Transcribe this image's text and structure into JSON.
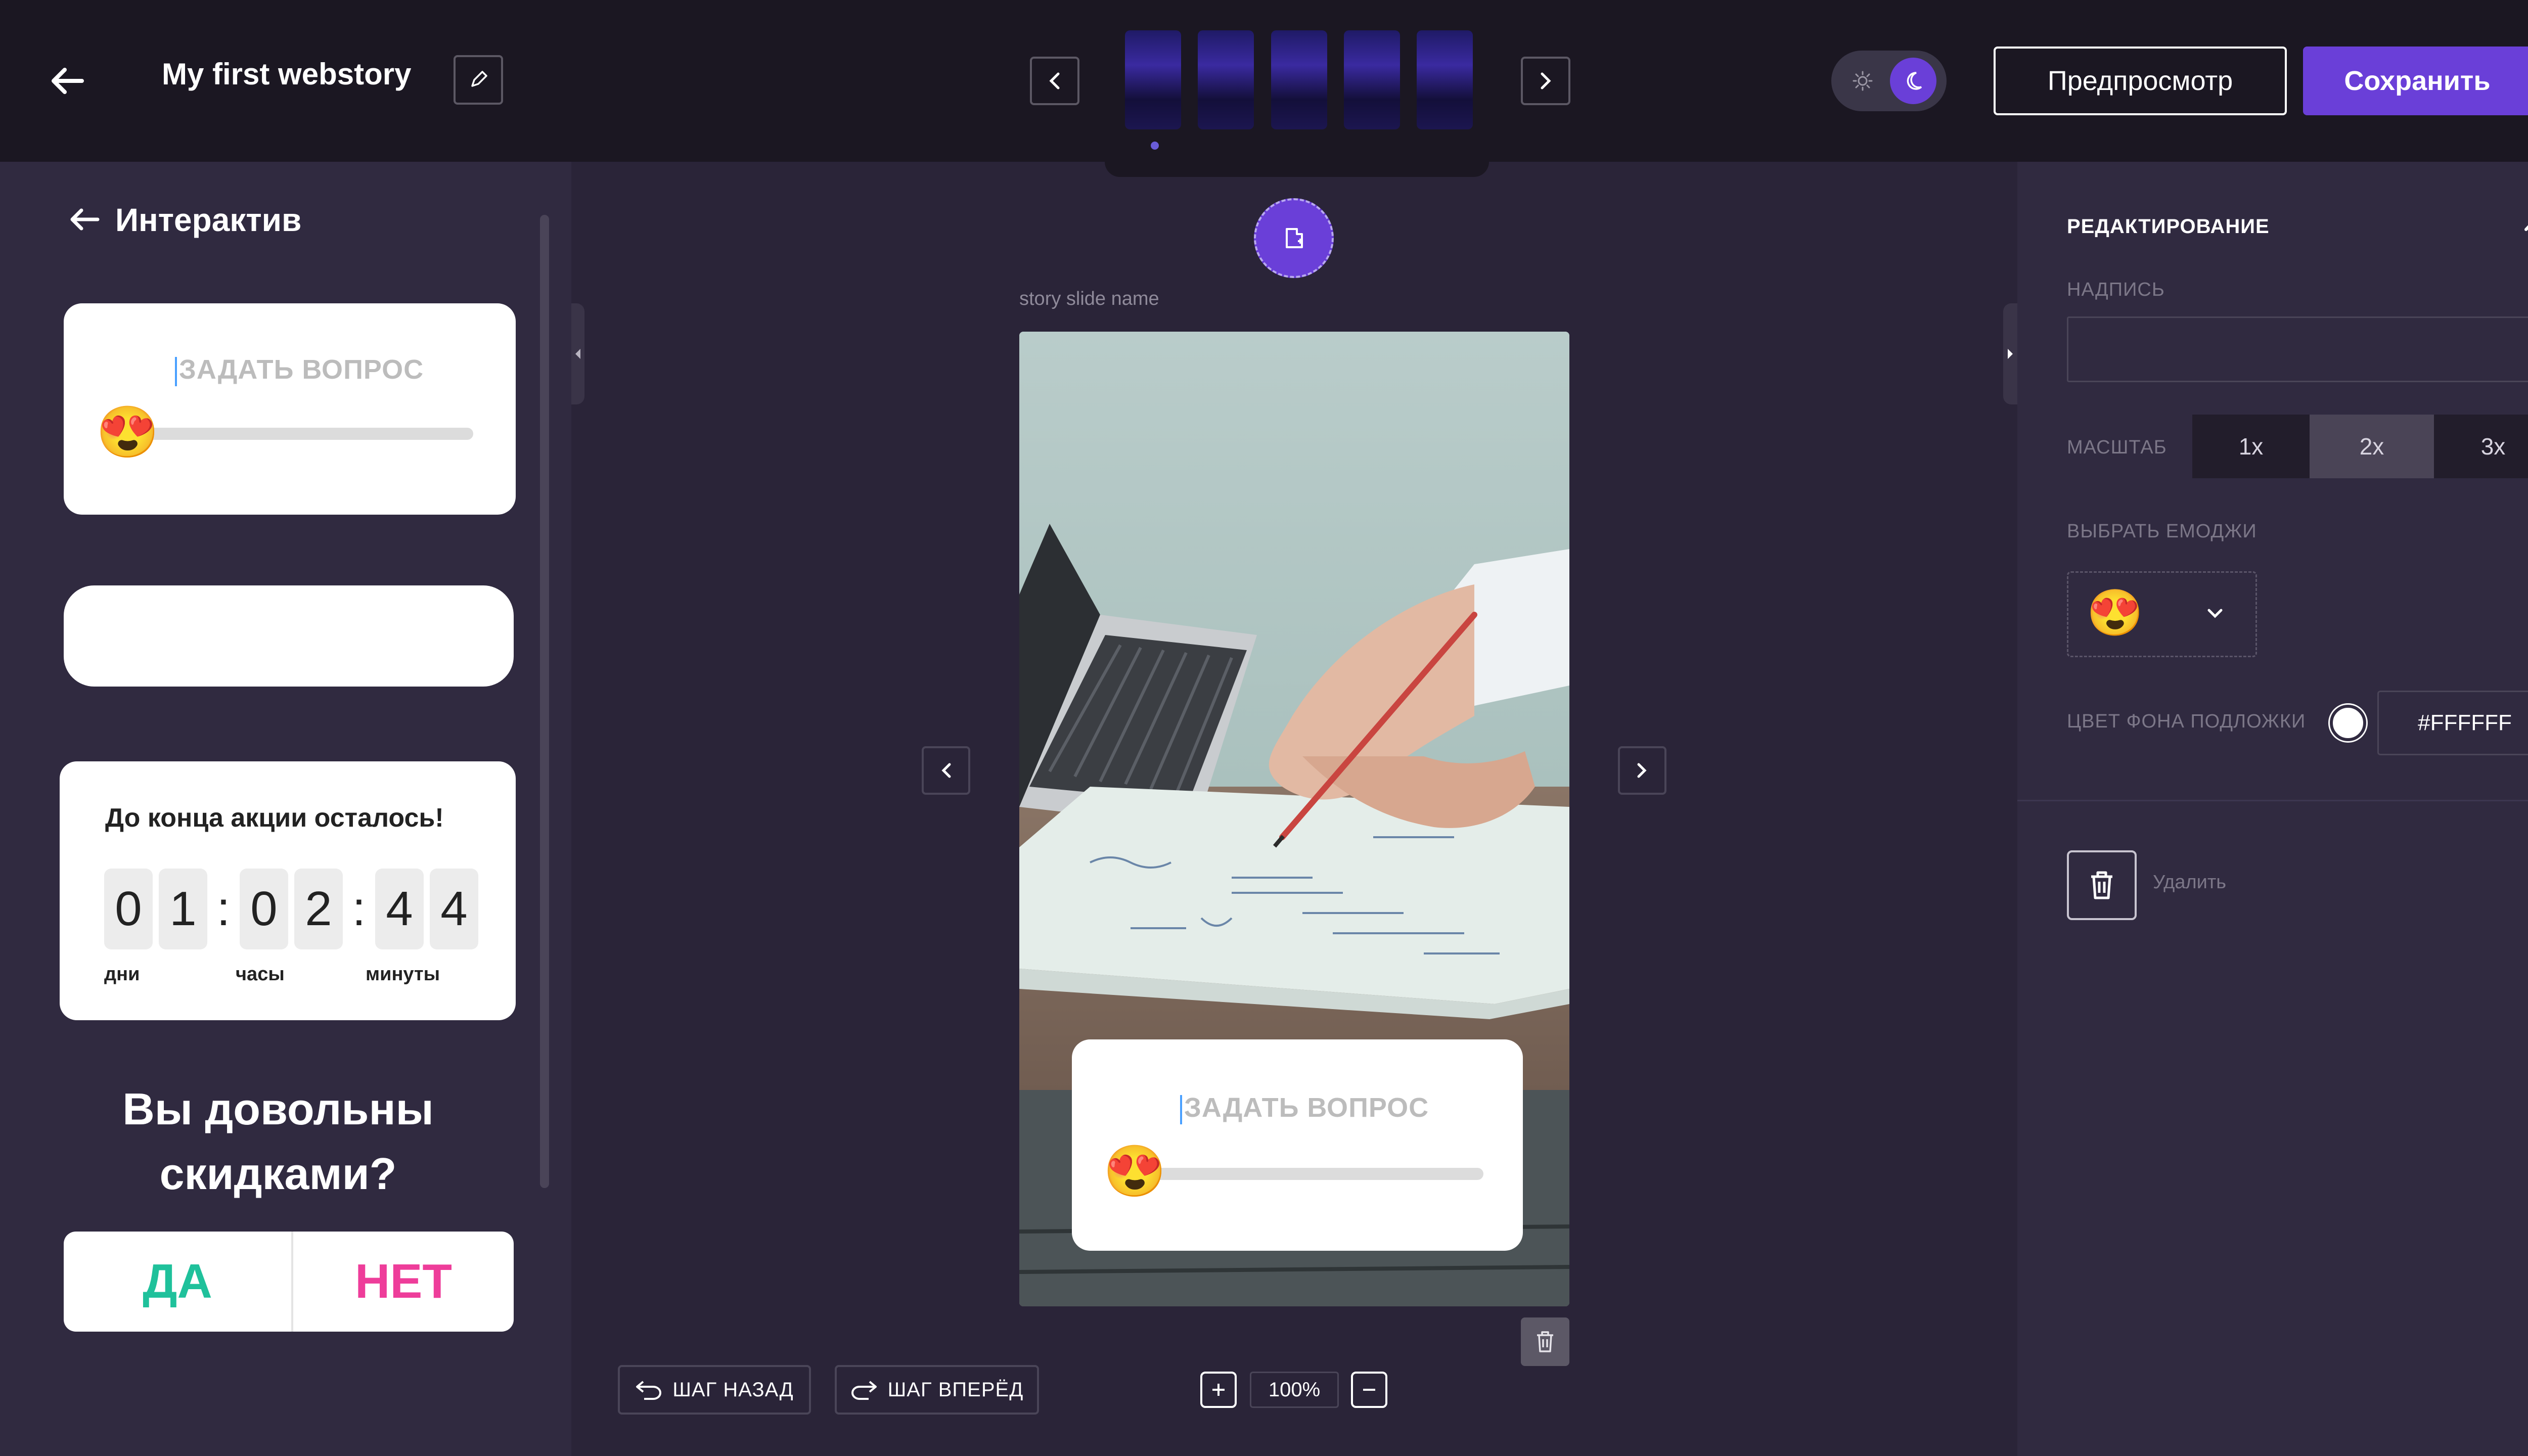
{
  "header": {
    "title": "My first webstory",
    "preview_label": "Предпросмотр",
    "save_label": "Сохранить"
  },
  "left_panel": {
    "title": "Интерактив",
    "slider_widget": {
      "placeholder": "ЗАДАТЬ ВОПРОС",
      "emoji": "😍"
    },
    "timer_widget": {
      "title": "До конца акции осталось!",
      "digits": [
        "0",
        "1",
        "0",
        "2",
        "4",
        "4"
      ],
      "labels": {
        "days": "дни",
        "hours": "часы",
        "minutes": "минуты"
      }
    },
    "poll_widget": {
      "question": "Вы довольны скидками?",
      "yes": "ДА",
      "no": "НЕТ"
    }
  },
  "canvas": {
    "slide_name": "story slide name",
    "slider_placeholder": "ЗАДАТЬ ВОПРОС",
    "emoji": "😍",
    "undo_label": "ШАГ НАЗАД",
    "redo_label": "ШАГ ВПЕРЁД",
    "zoom": "100%"
  },
  "right_panel": {
    "section_title": "РЕДАКТИРОВАНИЕ",
    "caption_label": "НАДПИСЬ",
    "caption_value": "",
    "scale_label": "МАСШТАБ",
    "scale_options": [
      "1x",
      "2x",
      "3x"
    ],
    "scale_selected": "2x",
    "emoji_label": "ВЫБРАТЬ ЕМОДЖИ",
    "emoji": "😍",
    "bg_color_label": "ЦВЕТ ФОНА ПОДЛОЖКИ",
    "bg_color_value": "#FFFFFF",
    "delete_label": "Удалить"
  },
  "colors": {
    "accent": "#6a3fd8",
    "yes_green": "#1fc19b",
    "no_pink": "#ee3d9a",
    "topbar_bg": "#1b1722",
    "panel_bg": "#302a40",
    "workspace_bg": "#2a2438"
  },
  "icons": [
    "back-arrow-icon",
    "pencil-icon",
    "chevron-left-icon",
    "chevron-right-icon",
    "sun-icon",
    "moon-icon",
    "add-slide-icon",
    "trash-icon",
    "undo-icon",
    "redo-icon",
    "plus-icon",
    "minus-icon",
    "chevron-up-icon",
    "chevron-down-icon",
    "collapse-left-icon",
    "collapse-right-icon"
  ]
}
